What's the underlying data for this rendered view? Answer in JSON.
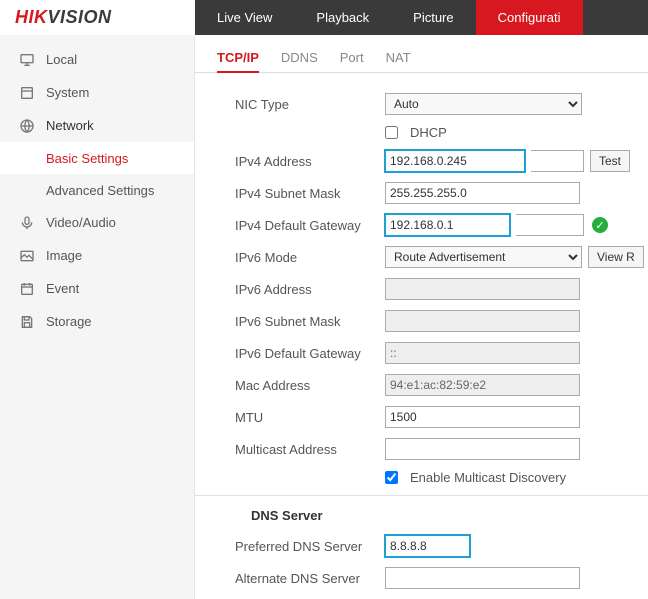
{
  "brand": {
    "part1": "HIK",
    "part2": "VISION"
  },
  "topnav": {
    "live": "Live View",
    "playback": "Playback",
    "picture": "Picture",
    "config": "Configurati"
  },
  "sidebar": {
    "local": "Local",
    "system": "System",
    "network": "Network",
    "basic": "Basic Settings",
    "advanced": "Advanced Settings",
    "video": "Video/Audio",
    "image": "Image",
    "event": "Event",
    "storage": "Storage"
  },
  "tabs": {
    "tcpip": "TCP/IP",
    "ddns": "DDNS",
    "port": "Port",
    "nat": "NAT"
  },
  "form": {
    "nic_type_label": "NIC Type",
    "nic_type_value": "Auto",
    "dhcp_label": "DHCP",
    "ipv4_addr_label": "IPv4 Address",
    "ipv4_addr_value": "192.168.0.245",
    "test_btn": "Test",
    "ipv4_mask_label": "IPv4 Subnet Mask",
    "ipv4_mask_value": "255.255.255.0",
    "ipv4_gw_label": "IPv4 Default Gateway",
    "ipv4_gw_value": "192.168.0.1",
    "ipv6_mode_label": "IPv6 Mode",
    "ipv6_mode_value": "Route Advertisement",
    "viewr_btn": "View R",
    "ipv6_addr_label": "IPv6 Address",
    "ipv6_mask_label": "IPv6 Subnet Mask",
    "ipv6_gw_label": "IPv6 Default Gateway",
    "ipv6_gw_value": "::",
    "mac_label": "Mac Address",
    "mac_value": "94:e1:ac:82:59:e2",
    "mtu_label": "MTU",
    "mtu_value": "1500",
    "multicast_label": "Multicast Address",
    "enable_multicast": "Enable Multicast Discovery",
    "dns_section": "DNS Server",
    "pref_dns_label": "Preferred DNS Server",
    "pref_dns_value": "8.8.8.8",
    "alt_dns_label": "Alternate DNS Server"
  }
}
